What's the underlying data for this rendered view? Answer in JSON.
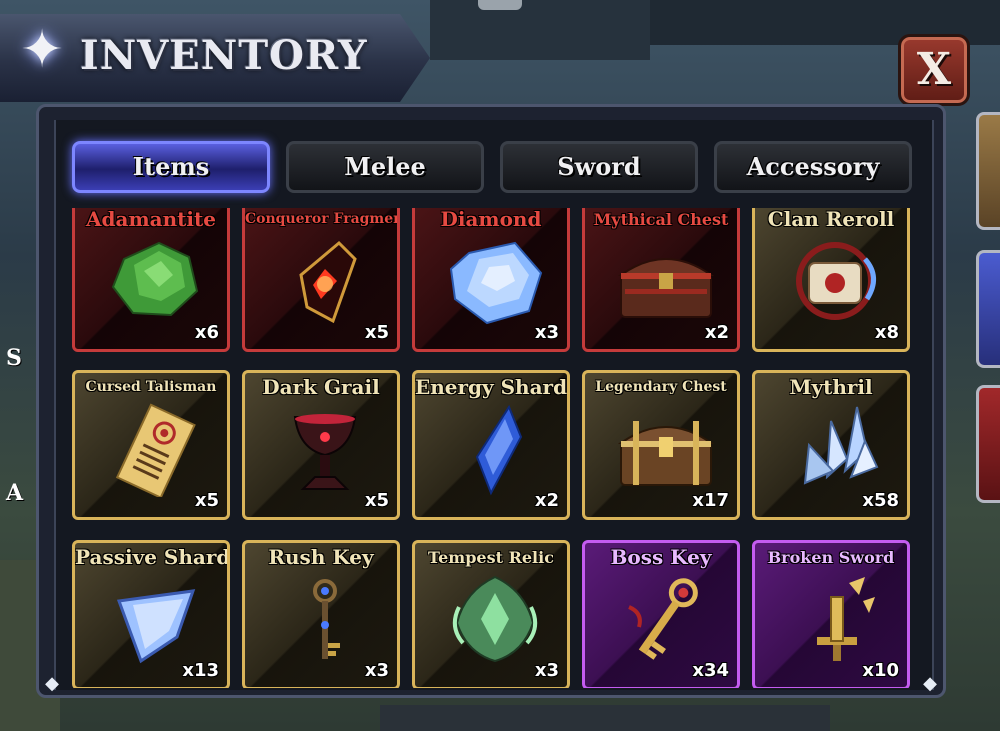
{
  "window": {
    "title": "INVENTORY",
    "close_label": "X"
  },
  "tabs": [
    {
      "label": "Items",
      "active": true
    },
    {
      "label": "Melee",
      "active": false
    },
    {
      "label": "Sword",
      "active": false
    },
    {
      "label": "Accessory",
      "active": false
    }
  ],
  "items": [
    {
      "name": "Adamantite",
      "count": "x6",
      "rarity": "red",
      "icon": "green-crystal-icon"
    },
    {
      "name": "Conqueror Fragment",
      "count": "x5",
      "rarity": "red",
      "icon": "red-fragment-icon"
    },
    {
      "name": "Diamond",
      "count": "x3",
      "rarity": "red",
      "icon": "diamond-icon"
    },
    {
      "name": "Mythical Chest",
      "count": "x2",
      "rarity": "red",
      "icon": "mythical-chest-icon"
    },
    {
      "name": "Clan Reroll",
      "count": "x8",
      "rarity": "gold",
      "icon": "scroll-icon"
    },
    {
      "name": "Cursed Talisman",
      "count": "x5",
      "rarity": "gold",
      "icon": "talisman-icon"
    },
    {
      "name": "Dark Grail",
      "count": "x5",
      "rarity": "gold",
      "icon": "grail-icon"
    },
    {
      "name": "Energy Shard",
      "count": "x2",
      "rarity": "gold",
      "icon": "energy-shard-icon"
    },
    {
      "name": "Legendary Chest",
      "count": "x17",
      "rarity": "gold",
      "icon": "legendary-chest-icon"
    },
    {
      "name": "Mythril",
      "count": "x58",
      "rarity": "gold",
      "icon": "mythril-icon"
    },
    {
      "name": "Passive Shard",
      "count": "x13",
      "rarity": "gold",
      "icon": "passive-shard-icon"
    },
    {
      "name": "Rush Key",
      "count": "x3",
      "rarity": "gold",
      "icon": "rush-key-icon"
    },
    {
      "name": "Tempest Relic",
      "count": "x3",
      "rarity": "gold",
      "icon": "relic-icon"
    },
    {
      "name": "Boss Key",
      "count": "x34",
      "rarity": "purple",
      "icon": "boss-key-icon"
    },
    {
      "name": "Broken Sword",
      "count": "x10",
      "rarity": "purple",
      "icon": "broken-sword-icon"
    }
  ],
  "side": {
    "letter_s": "S",
    "letter_a": "A"
  },
  "colors": {
    "red_rarity": "#c53b3b",
    "gold_rarity": "#d9b45a",
    "purple_rarity": "#c45cf0",
    "active_tab": "#5a5fe0"
  }
}
